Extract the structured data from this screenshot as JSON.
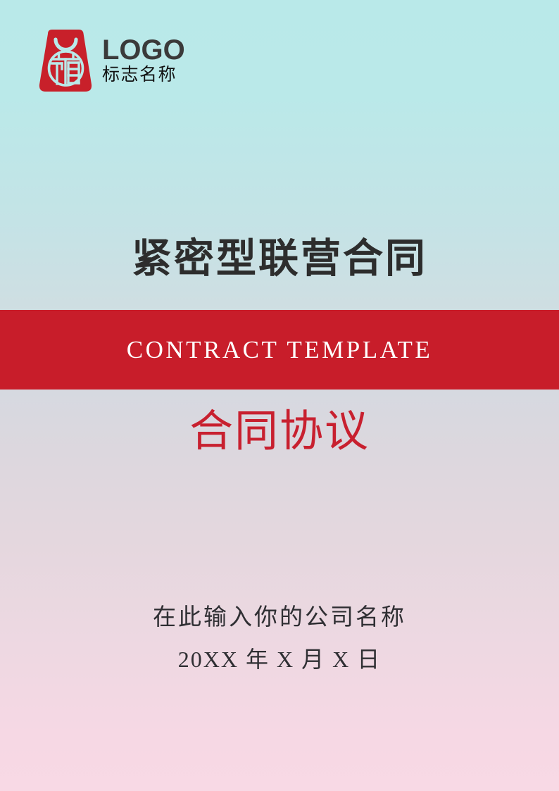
{
  "document": {
    "type": "contract-cover-page",
    "page_size": "794x1123"
  },
  "colors": {
    "band_red": "#c81d2a",
    "title_red": "#c8202f",
    "logo_red": "#c8202a",
    "bg_top": "#b9e9e9",
    "bg_mid": "#d8d9e0",
    "bg_bottom": "#f7d8e4",
    "title_dark": "#2d2d2d"
  },
  "logo": {
    "mark_name": "shopping-bag-fu-logo",
    "mark_glyph": "福",
    "word": "LOGO",
    "sub": "标志名称"
  },
  "title": {
    "main": "紧密型联营合同"
  },
  "band": {
    "text": "CONTRACT  TEMPLATE"
  },
  "subtitle": {
    "text": "合同协议"
  },
  "footer": {
    "company_placeholder": "在此输入你的公司名称",
    "date_placeholder": "20XX 年 X 月 X 日"
  }
}
